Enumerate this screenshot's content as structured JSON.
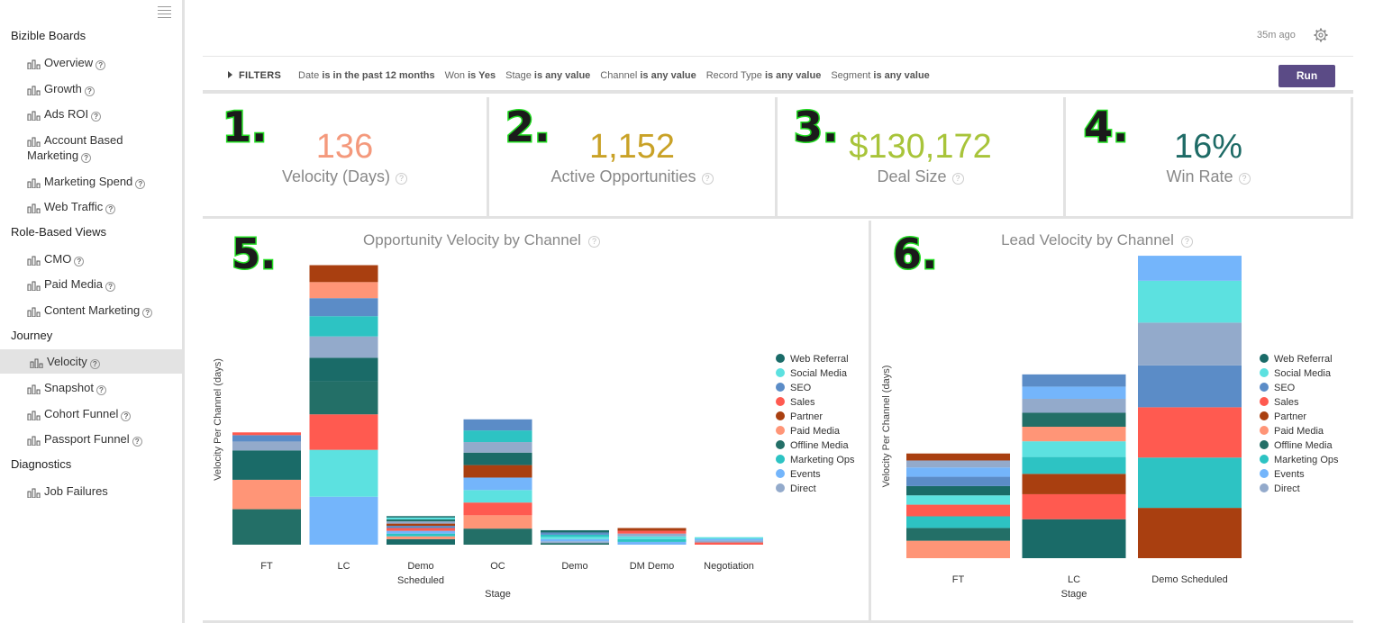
{
  "sidebar": {
    "sections": [
      {
        "title": "Bizible Boards",
        "items": [
          {
            "label": "Overview"
          },
          {
            "label": "Growth"
          },
          {
            "label": "Ads ROI"
          },
          {
            "label": "Account Based",
            "label2": "Marketing"
          },
          {
            "label": "Marketing Spend"
          },
          {
            "label": "Web Traffic"
          }
        ]
      },
      {
        "title": "Role-Based Views",
        "items": [
          {
            "label": "CMO"
          },
          {
            "label": "Paid Media"
          },
          {
            "label": "Content Marketing"
          }
        ]
      },
      {
        "title": "Journey",
        "items": [
          {
            "label": "Velocity",
            "active": true
          },
          {
            "label": "Snapshot"
          },
          {
            "label": "Cohort Funnel"
          },
          {
            "label": "Passport Funnel"
          }
        ]
      },
      {
        "title": "Diagnostics",
        "items": [
          {
            "label": "Job Failures",
            "noHelp": true
          }
        ]
      }
    ],
    "help_glyph": "?"
  },
  "header": {
    "updated": "35m ago",
    "settings_icon": "gear-icon"
  },
  "filters": {
    "toggle_label": "FILTERS",
    "items": [
      {
        "field": "Date",
        "cond": "is in the past 12 months"
      },
      {
        "field": "Won",
        "cond": "is Yes"
      },
      {
        "field": "Stage",
        "cond": "is any value"
      },
      {
        "field": "Channel",
        "cond": "is any value"
      },
      {
        "field": "Record Type",
        "cond": "is any value"
      },
      {
        "field": "Segment",
        "cond": "is any value"
      }
    ],
    "run_label": "Run"
  },
  "kpis": [
    {
      "badge": "1.",
      "value": "136",
      "label": "Velocity (Days)",
      "color": "#f4997c"
    },
    {
      "badge": "2.",
      "value": "1,152",
      "label": "Active Opportunities",
      "color": "#c9a227"
    },
    {
      "badge": "3.",
      "value": "$130,172",
      "label": "Deal Size",
      "color": "#a8c43a"
    },
    {
      "badge": "4.",
      "value": "16%",
      "label": "Win Rate",
      "color": "#1e6b66"
    }
  ],
  "colors": {
    "Web Referral": "#1a6b68",
    "Social Media": "#5ce1e0",
    "SEO": "#5b8cc7",
    "Sales": "#ff5a50",
    "Partner": "#a93f10",
    "Paid Media": "#ff9577",
    "Offline Media": "#236f67",
    "Marketing Ops": "#2dc3c3",
    "Events": "#74b5fb",
    "Direct": "#93aacb"
  },
  "chart_data": [
    {
      "type": "bar",
      "stacked": true,
      "badge": "5.",
      "title": "Opportunity Velocity by Channel",
      "xlabel": "Stage",
      "ylabel": "Velocity Per Channel (days)",
      "categories": [
        "FT",
        "LC",
        "Demo Scheduled",
        "OC",
        "Demo",
        "DM Demo",
        "Negotiation"
      ],
      "legend": [
        "Web Referral",
        "Social Media",
        "SEO",
        "Sales",
        "Partner",
        "Paid Media",
        "Offline Media",
        "Marketing Ops",
        "Events",
        "Direct"
      ],
      "ylim": [
        0,
        100
      ],
      "stacks": [
        [
          {
            "s": "Offline Media",
            "v": 12.8
          },
          {
            "s": "Paid Media",
            "v": 10.6
          },
          {
            "s": "Web Referral",
            "v": 10.6
          },
          {
            "s": "Direct",
            "v": 3.2
          },
          {
            "s": "SEO",
            "v": 2.3
          },
          {
            "s": "Sales",
            "v": 1.0
          }
        ],
        [
          {
            "s": "Events",
            "v": 17.3
          },
          {
            "s": "Social Media",
            "v": 16.9
          },
          {
            "s": "Sales",
            "v": 12.8
          },
          {
            "s": "Offline Media",
            "v": 11.9
          },
          {
            "s": "Web Referral",
            "v": 8.5
          },
          {
            "s": "Direct",
            "v": 7.7
          },
          {
            "s": "Marketing Ops",
            "v": 7.3
          },
          {
            "s": "SEO",
            "v": 6.5
          },
          {
            "s": "Paid Media",
            "v": 5.8
          },
          {
            "s": "Partner",
            "v": 6.1
          }
        ],
        [
          {
            "s": "Web Referral",
            "v": 2.0
          },
          {
            "s": "Paid Media",
            "v": 1.0
          },
          {
            "s": "Marketing Ops",
            "v": 1.0
          },
          {
            "s": "Events",
            "v": 1.0
          },
          {
            "s": "Sales",
            "v": 1.0
          },
          {
            "s": "SEO",
            "v": 0.8
          },
          {
            "s": "Partner",
            "v": 0.8
          },
          {
            "s": "Direct",
            "v": 0.8
          },
          {
            "s": "Offline Media",
            "v": 0.7
          },
          {
            "s": "Social Media",
            "v": 0.7
          },
          {
            "s": "Web Referral",
            "v": 0.5
          }
        ],
        [
          {
            "s": "Offline Media",
            "v": 5.8
          },
          {
            "s": "Paid Media",
            "v": 4.8
          },
          {
            "s": "Sales",
            "v": 4.6
          },
          {
            "s": "Social Media",
            "v": 4.5
          },
          {
            "s": "Events",
            "v": 4.5
          },
          {
            "s": "Partner",
            "v": 4.5
          },
          {
            "s": "Web Referral",
            "v": 4.5
          },
          {
            "s": "Direct",
            "v": 3.8
          },
          {
            "s": "Marketing Ops",
            "v": 4.2
          },
          {
            "s": "SEO",
            "v": 4.0
          }
        ],
        [
          {
            "s": "Offline Media",
            "v": 0.6
          },
          {
            "s": "Direct",
            "v": 0.6
          },
          {
            "s": "Events",
            "v": 0.8
          },
          {
            "s": "Social Media",
            "v": 0.8
          },
          {
            "s": "Marketing Ops",
            "v": 0.8
          },
          {
            "s": "SEO",
            "v": 0.8
          },
          {
            "s": "Web Referral",
            "v": 0.8
          }
        ],
        [
          {
            "s": "Events",
            "v": 1.0
          },
          {
            "s": "Marketing Ops",
            "v": 1.0
          },
          {
            "s": "Social Media",
            "v": 1.0
          },
          {
            "s": "Direct",
            "v": 1.0
          },
          {
            "s": "Sales",
            "v": 1.0
          },
          {
            "s": "Partner",
            "v": 1.0
          }
        ],
        [
          {
            "s": "Sales",
            "v": 0.8
          },
          {
            "s": "Direct",
            "v": 0.7
          },
          {
            "s": "Events",
            "v": 0.6
          },
          {
            "s": "Social Media",
            "v": 0.6
          }
        ]
      ]
    },
    {
      "type": "bar",
      "stacked": true,
      "badge": "6.",
      "title": "Lead Velocity by Channel",
      "xlabel": "Stage",
      "ylabel": "Velocity Per Channel (days)",
      "categories": [
        "FT",
        "LC",
        "Demo Scheduled"
      ],
      "legend": [
        "Web Referral",
        "Social Media",
        "SEO",
        "Sales",
        "Partner",
        "Paid Media",
        "Offline Media",
        "Marketing Ops",
        "Events",
        "Direct"
      ],
      "ylim": [
        0,
        100
      ],
      "stacks": [
        [
          {
            "s": "Paid Media",
            "v": 6.0
          },
          {
            "s": "Offline Media",
            "v": 4.4
          },
          {
            "s": "Marketing Ops",
            "v": 4.0
          },
          {
            "s": "Sales",
            "v": 4.0
          },
          {
            "s": "Social Media",
            "v": 3.2
          },
          {
            "s": "Web Referral",
            "v": 3.2
          },
          {
            "s": "SEO",
            "v": 3.2
          },
          {
            "s": "Events",
            "v": 3.2
          },
          {
            "s": "Direct",
            "v": 2.4
          },
          {
            "s": "Partner",
            "v": 2.4
          }
        ],
        [
          {
            "s": "Web Referral",
            "v": 13.4
          },
          {
            "s": "Sales",
            "v": 8.6
          },
          {
            "s": "Partner",
            "v": 7.0
          },
          {
            "s": "Marketing Ops",
            "v": 5.8
          },
          {
            "s": "Social Media",
            "v": 5.4
          },
          {
            "s": "Paid Media",
            "v": 5.0
          },
          {
            "s": "Offline Media",
            "v": 4.8
          },
          {
            "s": "Direct",
            "v": 4.8
          },
          {
            "s": "Events",
            "v": 4.2
          },
          {
            "s": "SEO",
            "v": 4.2
          }
        ],
        [
          {
            "s": "Partner",
            "v": 17.3
          },
          {
            "s": "Marketing Ops",
            "v": 17.3
          },
          {
            "s": "Sales",
            "v": 17.3
          },
          {
            "s": "SEO",
            "v": 14.4
          },
          {
            "s": "Direct",
            "v": 14.7
          },
          {
            "s": "Social Media",
            "v": 14.4
          },
          {
            "s": "Events",
            "v": 8.6
          }
        ]
      ]
    }
  ]
}
